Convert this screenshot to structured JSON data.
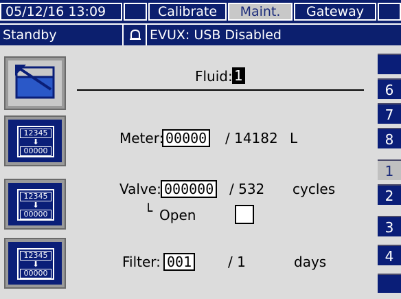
{
  "header": {
    "datetime": "05/12/16 13:09",
    "tabs": [
      {
        "label": "Calibrate",
        "active": false
      },
      {
        "label": "Maint.",
        "active": true
      },
      {
        "label": "Gateway",
        "active": false
      }
    ]
  },
  "status": {
    "mode": "Standby",
    "message": "EVUX: USB Disabled",
    "alarm_icon": "bell-icon"
  },
  "fluid": {
    "label": "Fluid:",
    "value": "1"
  },
  "rows": {
    "meter": {
      "label": "Meter:",
      "value": "00000",
      "total": "/ 14182",
      "unit": "L"
    },
    "valve": {
      "label": "Valve:",
      "value": "000000",
      "total": "/ 532",
      "unit": "cycles"
    },
    "open": {
      "prefix": "└",
      "label": "Open",
      "checked": false
    },
    "filter": {
      "label": "Filter:",
      "value": "001",
      "total": "/ 1",
      "unit": "days"
    }
  },
  "reset_icon": {
    "top": "12345",
    "arrow": "⬇",
    "bottom": "00000"
  },
  "right_tabs": [
    "",
    "6",
    "7",
    "8",
    "1",
    "2",
    "3",
    "4",
    ""
  ],
  "right_active": "1",
  "colors": {
    "bar": "#0c1f6e",
    "button": "#0a1e78",
    "background": "#dcdcdc"
  }
}
